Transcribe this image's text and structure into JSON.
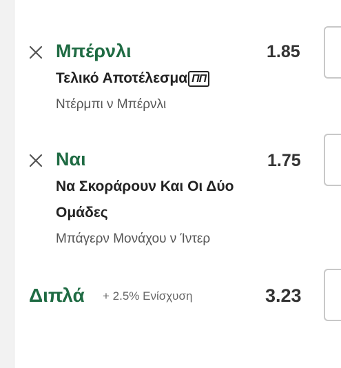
{
  "colors": {
    "accent": "#1f6b43",
    "text": "#222222",
    "muted": "#555555"
  },
  "selections": [
    {
      "remove_icon": "close-icon",
      "name": "Μπέρνλι",
      "odds": "1.85",
      "market": "Τελικό Αποτέλεσμα",
      "market_badge": "ΠΠ",
      "match": "Ντέρμπι ν Μπέρνλι"
    },
    {
      "remove_icon": "close-icon",
      "name": "Ναι",
      "odds": "1.75",
      "market_line1": "Να Σκοράρουν Και Οι Δύο",
      "market_line2": "Ομάδες",
      "match": "Μπάγερν Μονάχου ν Ίντερ"
    }
  ],
  "double": {
    "label": "Διπλά",
    "boost": "+ 2.5% Ενίσχυση",
    "odds": "3.23"
  }
}
